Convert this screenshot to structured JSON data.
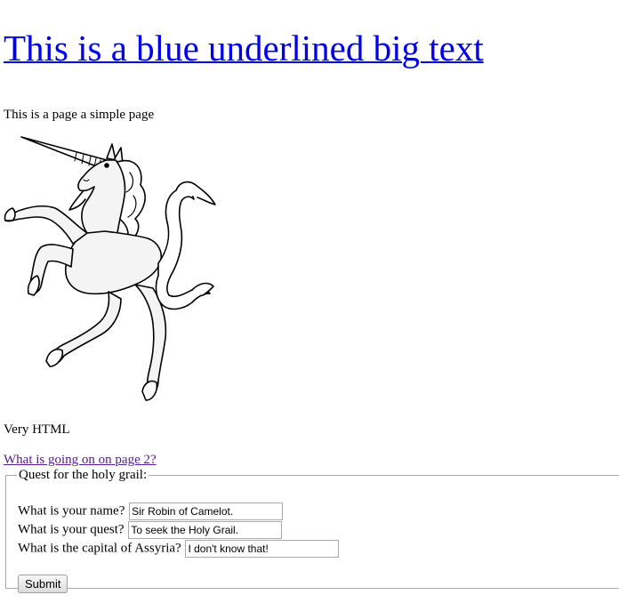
{
  "header": {
    "title": "This is a blue underlined big text"
  },
  "content": {
    "intro": "This is a page a simple page",
    "unicorn_image": "unicorn-icon",
    "tagline": "Very HTML",
    "page2_link": "What is going on on page 2?"
  },
  "form": {
    "legend": "Quest for the holy grail:",
    "fields": [
      {
        "label": "What is your name?",
        "value": "Sir Robin of Camelot."
      },
      {
        "label": "What is your quest?",
        "value": "To seek the Holy Grail."
      },
      {
        "label": "What is the capital of Assyria?",
        "value": "I don't know that!"
      }
    ],
    "submit_label": "Submit"
  },
  "colors": {
    "link": "#0000ee",
    "visited_link": "#551a8b",
    "fieldset_border": "#a9a9a9"
  }
}
